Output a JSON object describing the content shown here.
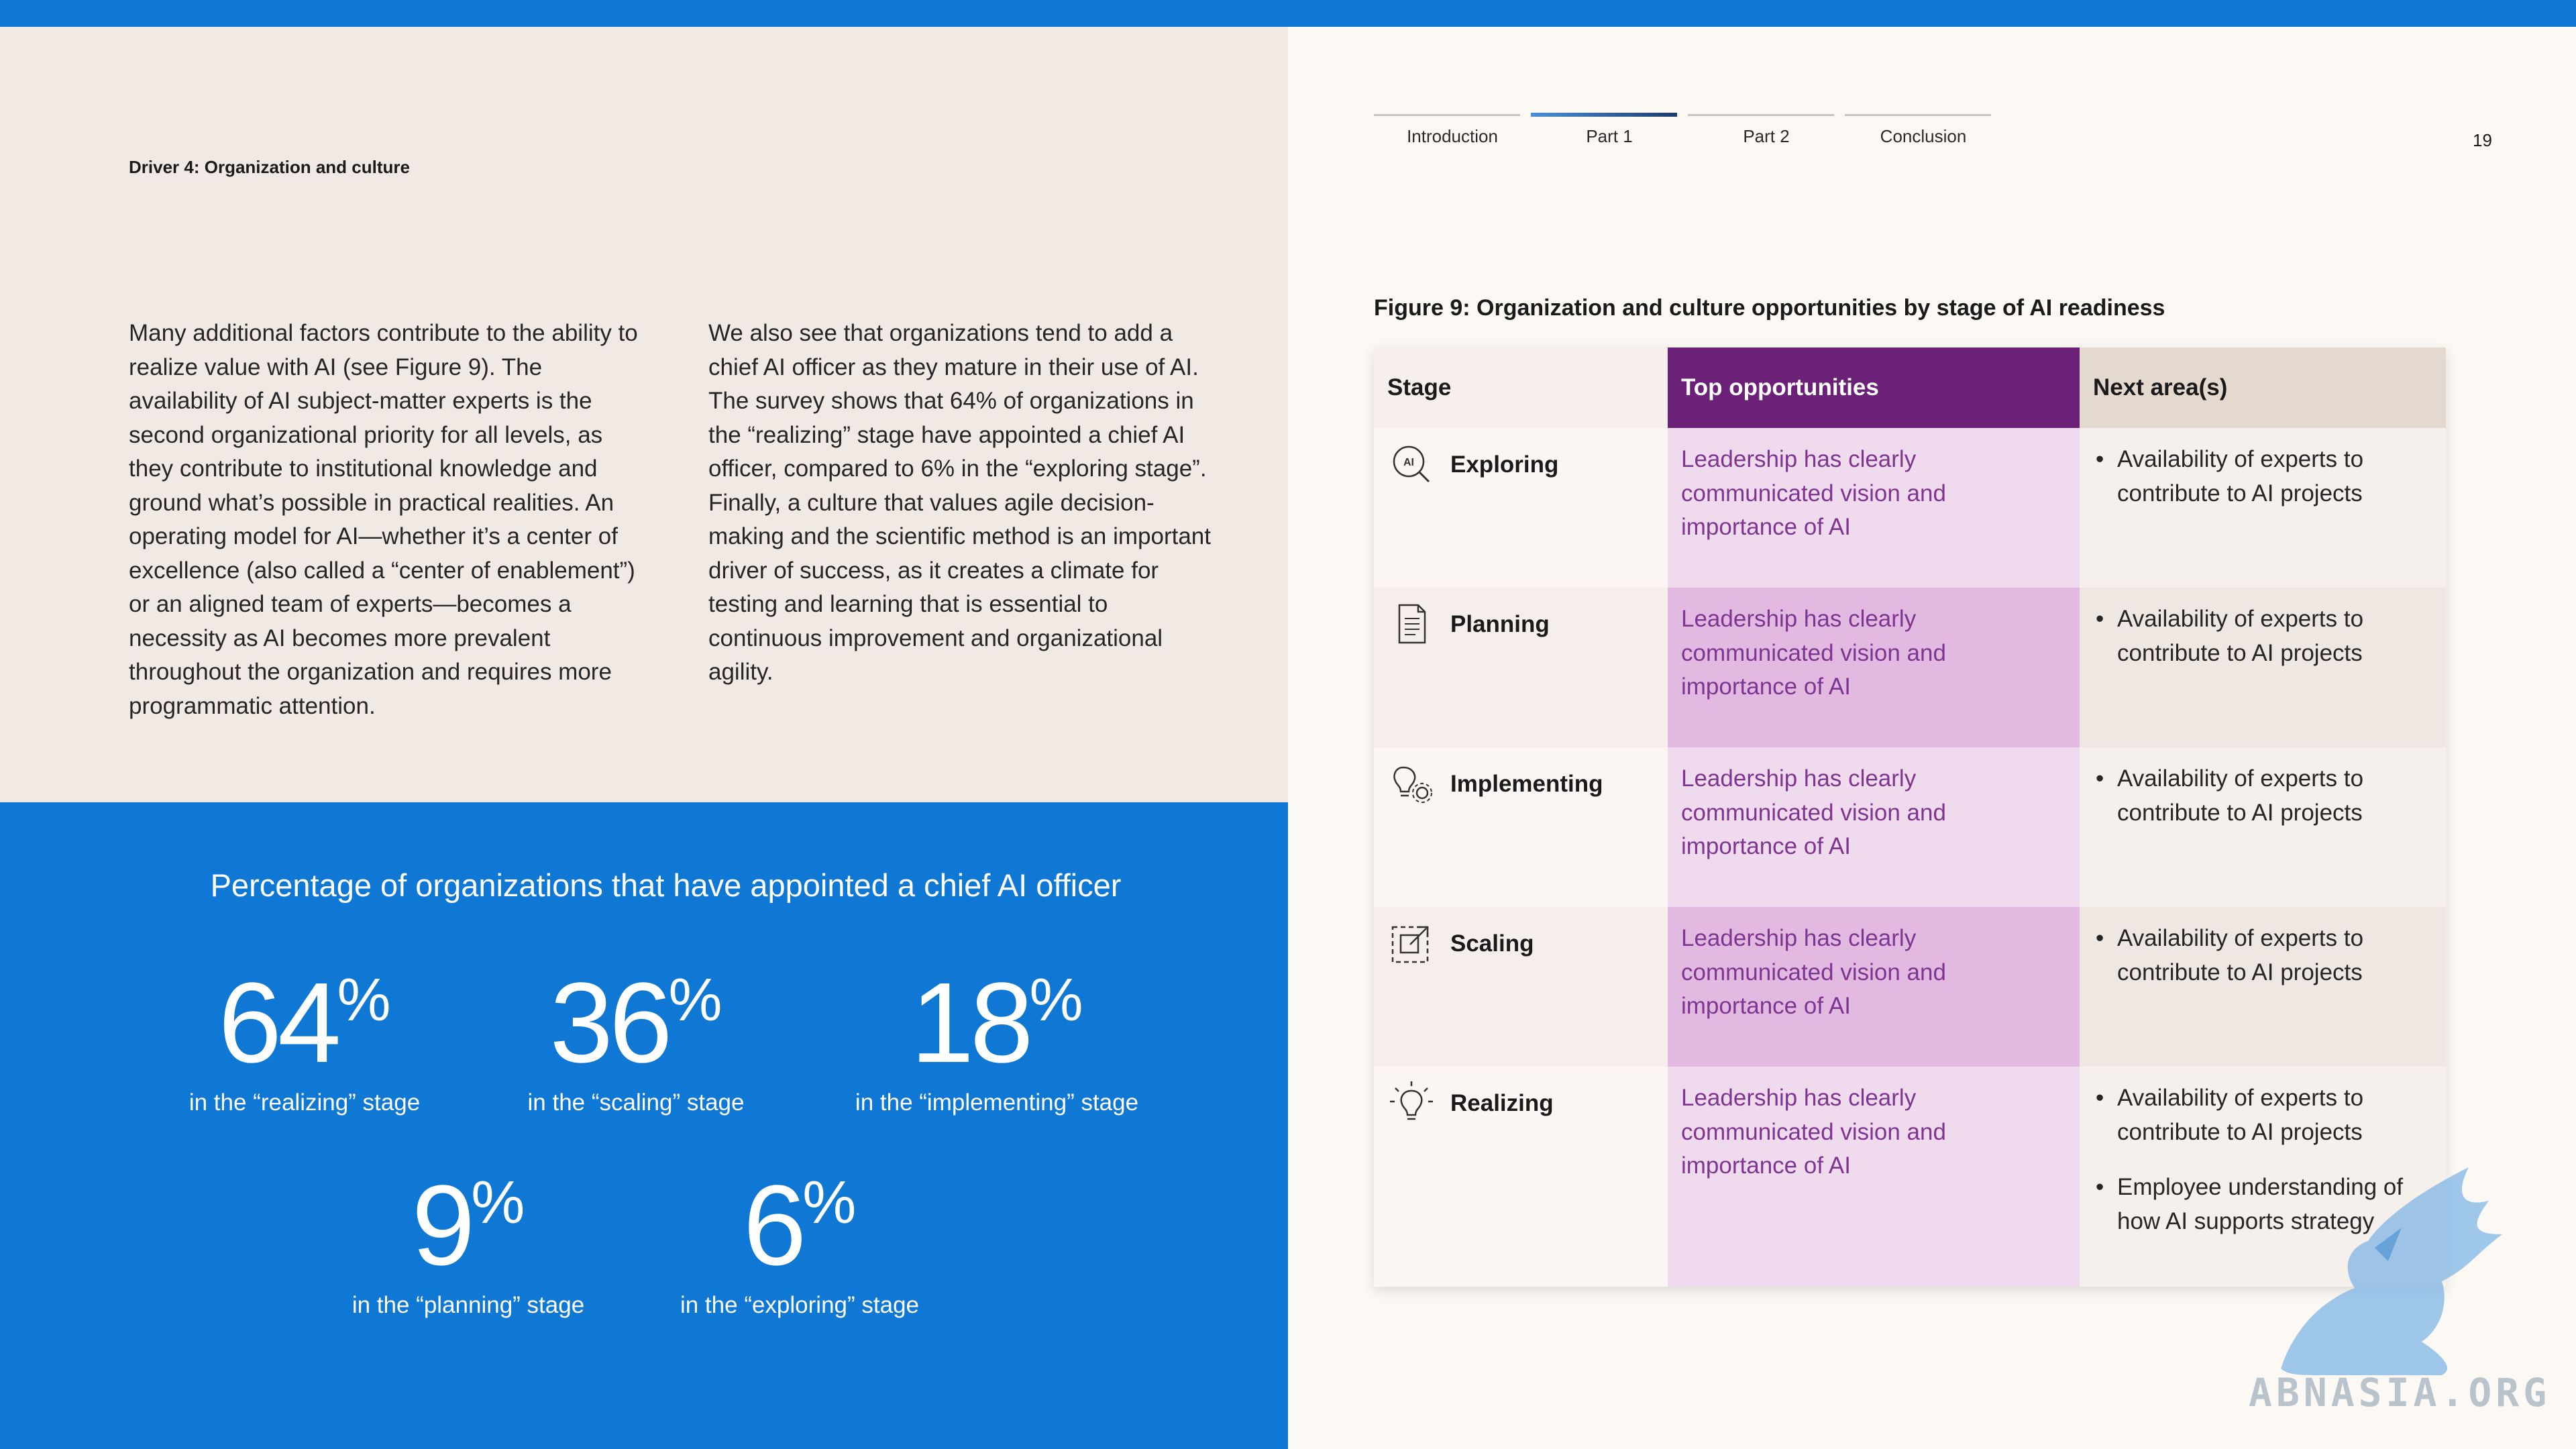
{
  "header": {
    "section_label": "Driver 4: Organization and culture",
    "page_number": "19",
    "nav": [
      {
        "label": "Introduction",
        "active": false
      },
      {
        "label": "Part 1",
        "active": true
      },
      {
        "label": "Part 2",
        "active": false
      },
      {
        "label": "Conclusion",
        "active": false
      }
    ]
  },
  "body": {
    "col1": "Many additional factors contribute to the ability to realize value with AI (see Figure 9). The availability of AI subject-matter experts is the second organizational priority for all levels, as they contribute to institutional knowledge and ground what’s possible in practical realities. An operating model for AI—whether it’s a center of excellence (also called a “center of enablement”) or an aligned team of experts—becomes a necessity as AI becomes more prevalent throughout the organization and requires more programmatic attention.",
    "col2": "We also see that organizations tend to add a chief AI officer as they mature in their use of AI. The survey shows that 64% of organizations in the “realizing” stage have appointed a chief AI officer, compared to 6% in the “exploring stage”. Finally, a culture that values agile decision-making and the scientific method is an important driver of success, as it creates a climate for testing and learning that is essential to continuous improvement and organizational agility."
  },
  "stats": {
    "title": "Percentage of organizations that have appointed a chief AI officer",
    "items": [
      {
        "value": "64",
        "unit": "%",
        "caption": "in the “realizing” stage"
      },
      {
        "value": "36",
        "unit": "%",
        "caption": "in the “scaling” stage"
      },
      {
        "value": "18",
        "unit": "%",
        "caption": "in the “implementing” stage"
      },
      {
        "value": "9",
        "unit": "%",
        "caption": "in the “planning” stage"
      },
      {
        "value": "6",
        "unit": "%",
        "caption": "in the “exploring” stage"
      }
    ]
  },
  "figure": {
    "title": "Figure 9: Organization and culture opportunities by stage of AI readiness",
    "headers": {
      "stage": "Stage",
      "top": "Top opportunities",
      "next": "Next area(s)"
    },
    "rows": [
      {
        "stage": "Exploring",
        "icon": "ai-search-icon",
        "top": "Leadership has clearly communicated vision and importance of AI",
        "next": [
          "Availability of experts to contribute to AI projects"
        ]
      },
      {
        "stage": "Planning",
        "icon": "document-icon",
        "top": "Leadership has clearly communicated vision and importance of AI",
        "next": [
          "Availability of experts to contribute to AI projects"
        ]
      },
      {
        "stage": "Implementing",
        "icon": "lightbulb-gear-icon",
        "top": "Leadership has clearly communicated vision and importance of AI",
        "next": [
          "Availability of experts to contribute to AI projects"
        ]
      },
      {
        "stage": "Scaling",
        "icon": "expand-icon",
        "top": "Leadership has clearly communicated vision and importance of AI",
        "next": [
          "Availability of experts to contribute to AI projects"
        ]
      },
      {
        "stage": "Realizing",
        "icon": "lightbulb-icon",
        "top": "Leadership has clearly communicated vision and importance of AI",
        "next": [
          "Availability of experts to contribute to AI projects",
          "Employee understanding of how AI supports strategy"
        ]
      }
    ]
  },
  "watermark": {
    "text": "ABNASIA.ORG"
  },
  "colors": {
    "blue": "#0f78d4",
    "purple": "#6a2177",
    "purple_text": "#7e3590"
  }
}
